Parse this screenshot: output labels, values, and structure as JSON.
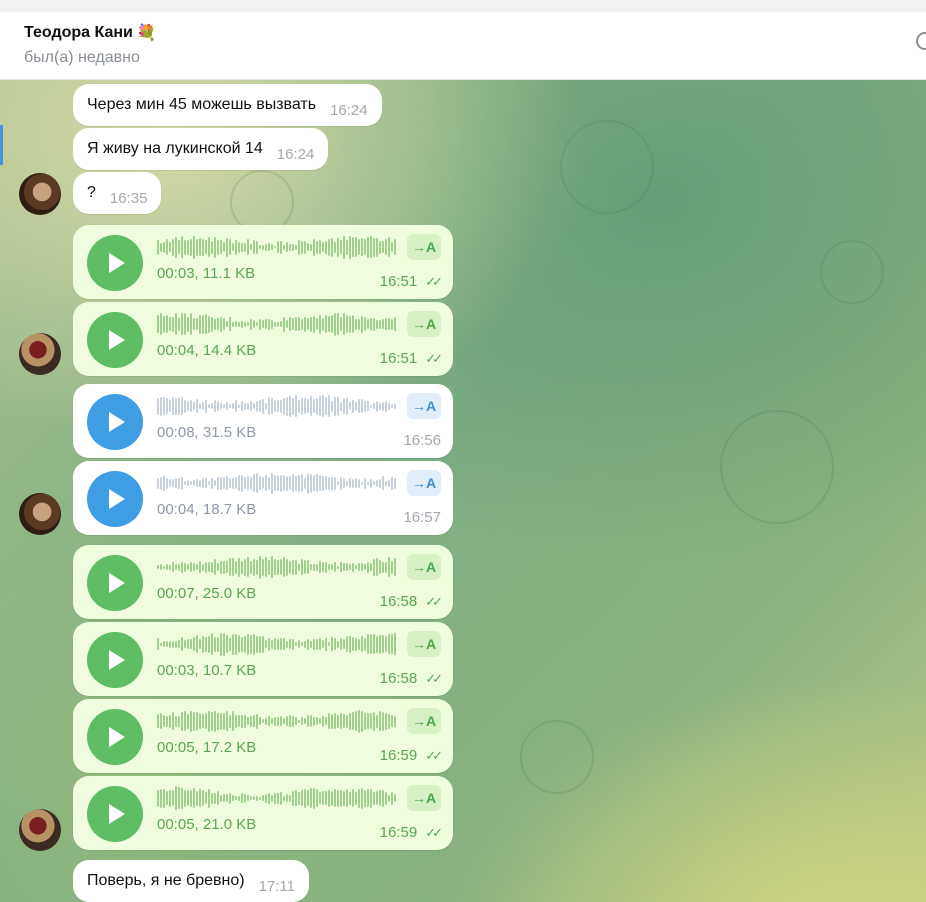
{
  "header": {
    "contact_name": "Теодора Кани",
    "emoji": "💐",
    "status": "был(а) недавно"
  },
  "messages": {
    "m1": {
      "text": "Через мин 45 можешь вызвать",
      "time": "16:24"
    },
    "m2": {
      "text": "Я живу на лукинской 14",
      "time": "16:24"
    },
    "m3": {
      "text": "?",
      "time": "16:35"
    },
    "v1": {
      "meta": "00:03, 11.1 KB",
      "time": "16:51",
      "transcribe": "→A"
    },
    "v2": {
      "meta": "00:04, 14.4 KB",
      "time": "16:51",
      "transcribe": "→A"
    },
    "v3": {
      "meta": "00:08, 31.5 KB",
      "time": "16:56",
      "transcribe": "→A"
    },
    "v4": {
      "meta": "00:04, 18.7 KB",
      "time": "16:57",
      "transcribe": "→A"
    },
    "v5": {
      "meta": "00:07, 25.0 KB",
      "time": "16:58",
      "transcribe": "→A"
    },
    "v6": {
      "meta": "00:03, 10.7 KB",
      "time": "16:58",
      "transcribe": "→A"
    },
    "v7": {
      "meta": "00:05, 17.2 KB",
      "time": "16:59",
      "transcribe": "→A"
    },
    "v8": {
      "meta": "00:05, 21.0 KB",
      "time": "16:59",
      "transcribe": "→A"
    },
    "m4": {
      "text": "Поверь, я не бревно)",
      "time": "17:11"
    }
  },
  "icons": {
    "play": "play-icon",
    "read_ticks": "double-check-icon",
    "transcribe": "speech-to-text-icon",
    "more": "more-icon"
  },
  "colors": {
    "outgoing_bubble": "#effdde",
    "outgoing_play": "#5fbe63",
    "incoming_play": "#3f9ee3",
    "outgoing_text": "#5aa64f"
  }
}
